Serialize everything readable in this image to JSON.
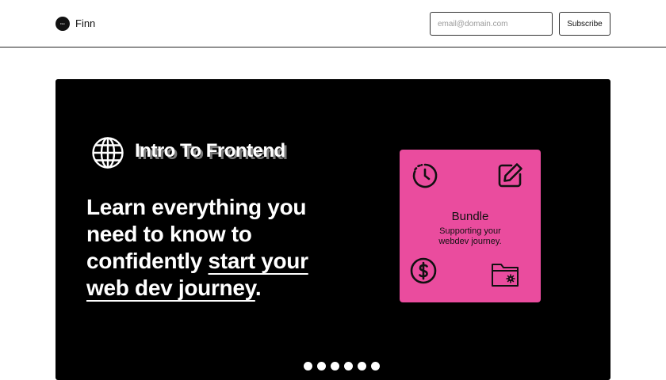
{
  "header": {
    "logo_text": "Finn",
    "brand_name": "Finn",
    "email_placeholder": "email@domain.com",
    "subscribe_label": "Subscribe"
  },
  "hero": {
    "course_title": "Intro To Frontend",
    "headline_plain": "Learn everything you need to know to confidently ",
    "headline_highlight": "start your web dev journey",
    "headline_end": ".",
    "card": {
      "title": "Bundle",
      "subtitle": "Supporting your webdev journey.",
      "color": "#ea4c9e",
      "icons": [
        "clock-icon",
        "edit-icon",
        "dollar-icon",
        "folder-settings-icon"
      ]
    },
    "carousel_dots": 6
  }
}
